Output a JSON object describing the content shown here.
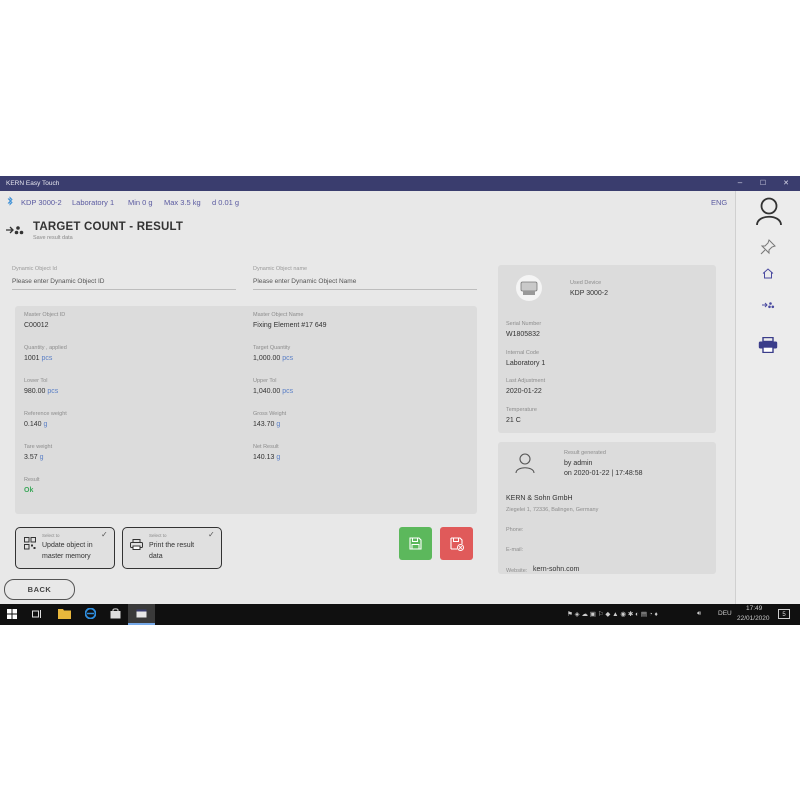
{
  "window": {
    "title": "KERN Easy Touch",
    "controls": {
      "minimize": "–",
      "maximize": "☐",
      "close": "✕"
    }
  },
  "status": {
    "device": "KDP 3000-2",
    "location": "Laboratory 1",
    "min": "Min 0 g",
    "max": "Max 3.5 kg",
    "d": "d 0.01 g",
    "language": "ENG"
  },
  "header": {
    "title": "TARGET COUNT - RESULT",
    "subtitle": "Save result data"
  },
  "fields": {
    "dynamic_id_label": "Dynamic Object Id",
    "dynamic_id_placeholder": "Please enter Dynamic Object ID",
    "dynamic_name_label": "Dynamic Object name",
    "dynamic_name_placeholder": "Please enter Dynamic Object Name"
  },
  "details": {
    "master_id_label": "Master Object ID",
    "master_id": "C00012",
    "master_name_label": "Master Object Name",
    "master_name": "Fixing Element #17 649",
    "qty_applied_label": "Quantity , applied",
    "qty_applied": "1001",
    "qty_applied_unit": "pcs",
    "target_qty_label": "Target Quantity",
    "target_qty": "1,000.00",
    "target_qty_unit": "pcs",
    "lower_tol_label": "Lower Tol",
    "lower_tol": "980.00",
    "lower_tol_unit": "pcs",
    "upper_tol_label": "Upper Tol",
    "upper_tol": "1,040.00",
    "upper_tol_unit": "pcs",
    "ref_weight_label": "Reference weight",
    "ref_weight": "0.140",
    "ref_weight_unit": "g",
    "gross_weight_label": "Gross Weight",
    "gross_weight": "143.70",
    "gross_weight_unit": "g",
    "tare_weight_label": "Tare weight",
    "tare_weight": "3.57",
    "tare_weight_unit": "g",
    "net_result_label": "Net Result",
    "net_result": "140.13",
    "net_result_unit": "g",
    "result_label": "Result",
    "result": "Ok"
  },
  "device": {
    "used_label": "Used Device",
    "used": "KDP 3000-2",
    "serial_label": "Serial Number",
    "serial": "W1805832",
    "internal_label": "Internal Code",
    "internal": "Laboratory 1",
    "adjust_label": "Last Adjustment",
    "adjust": "2020-01-22",
    "temp_label": "Temperature",
    "temp": "21 C"
  },
  "result_info": {
    "generated_label": "Result generated",
    "by": "by admin",
    "on": "on 2020-01-22 | 17:48:58",
    "company": "KERN & Sohn GmbH",
    "address": "Ziegelei 1, 72336, Balingen, Germany",
    "phone_label": "Phone:",
    "email_label": "E-mail:",
    "website_label": "Website:",
    "website": "kern-sohn.com"
  },
  "actions": {
    "select_to": "Select to",
    "update_line1": "Update object in",
    "update_line2": "master memory",
    "print_line1": "Print the result",
    "print_line2": "data",
    "check": "✓",
    "back": "BACK"
  },
  "taskbar": {
    "lang": "DEU",
    "time": "17:49",
    "date": "22/01/2020",
    "notif": "5"
  },
  "colors": {
    "accent": "#3a3d6e",
    "link": "#5a5aa0",
    "ok": "#3ca85a",
    "save_green": "#5cb85c",
    "save_red": "#e05a5a"
  }
}
